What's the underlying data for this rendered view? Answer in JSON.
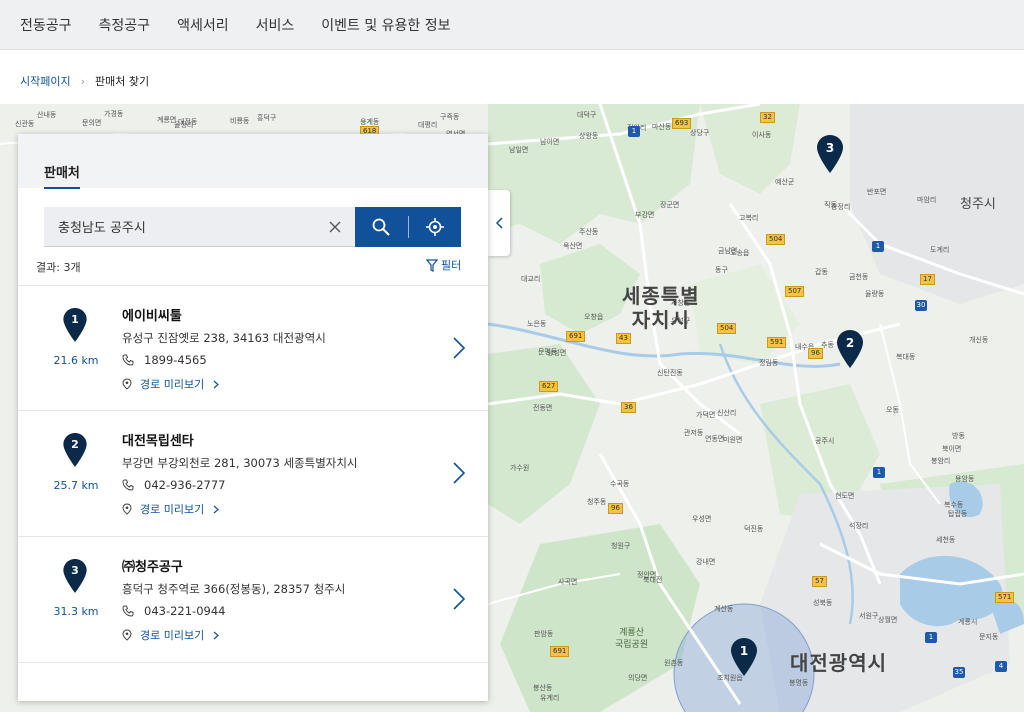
{
  "nav": {
    "items": [
      "전동공구",
      "측정공구",
      "액세서리",
      "서비스",
      "이벤트 및 유용한 정보"
    ]
  },
  "breadcrumb": {
    "home": "시작페이지",
    "current": "판매처 찾기"
  },
  "panel": {
    "tab_label": "판매처",
    "search": {
      "value": "충청남도 공주시"
    },
    "result_count": "결과: 3개",
    "filter_label": "필터",
    "route_label": "경로 미리보기",
    "results": [
      {
        "number": "1",
        "distance": "21.6 km",
        "name": "에이비씨툴",
        "address": "유성구 진잠옛로 238, 34163 대전광역시",
        "phone": "1899-4565"
      },
      {
        "number": "2",
        "distance": "25.7 km",
        "name": "대전목립센타",
        "address": "부강면 부강외천로 281, 30073 세종특별자치시",
        "phone": "042-936-2777"
      },
      {
        "number": "3",
        "distance": "31.3 km",
        "name": "㈜청주공구",
        "address": "흥덕구 청주역로 366(정봉동), 28357 청주시",
        "phone": "043-221-0944"
      }
    ]
  },
  "map": {
    "city_sejong_line1": "세종특별",
    "city_sejong_line2": "자치시",
    "city_daejeon": "대전광역시",
    "city_cheongju": "청주시",
    "mountain_line1": "계룡산",
    "mountain_line2": "국립공원",
    "pins": [
      "1",
      "2",
      "3"
    ],
    "labels": [
      "예산군",
      "신산리",
      "대평리",
      "정안면",
      "전동면",
      "송정리",
      "고복리",
      "연서면",
      "조치원읍",
      "연동면",
      "부강면",
      "금남면",
      "장군면",
      "유성구",
      "구즉동",
      "오송읍",
      "강내면",
      "옥산면",
      "남이면",
      "현도면",
      "신탄진동",
      "계산동",
      "동구",
      "반포면",
      "상월면",
      "계룡시",
      "공주시",
      "계룡면",
      "우성면",
      "의당면",
      "율정리",
      "유계리",
      "봉암리",
      "사곡면",
      "정안리",
      "석장리",
      "도계리",
      "상왕동",
      "신관동",
      "마암리",
      "대교리",
      "노은동",
      "북대전",
      "대덕구",
      "문평동",
      "비룡동",
      "용계동",
      "원촌동",
      "갑동",
      "판암동",
      "산내동",
      "가수원",
      "관저동",
      "정림동",
      "복수동",
      "탑립동",
      "문지동",
      "덕진동",
      "방동",
      "성북동",
      "봉산동",
      "추동",
      "오동",
      "세천동",
      "대전동",
      "직동",
      "주산동",
      "마산동",
      "이사동",
      "청주동",
      "율량동",
      "내수읍",
      "오창읍",
      "북이면",
      "문의면",
      "가덕면",
      "남일면",
      "미원면",
      "낭성면",
      "상당구",
      "서원구",
      "흥덕구",
      "청원구",
      "수곡동",
      "개신동",
      "복대동",
      "가경동",
      "봉명동",
      "사창동",
      "용암동",
      "금천동"
    ],
    "shields": [
      "618",
      "693",
      "1",
      "504",
      "507",
      "504",
      "591",
      "691",
      "43",
      "96",
      "627",
      "36",
      "1",
      "96",
      "57",
      "1",
      "691",
      "571",
      "35",
      "4",
      "30",
      "17",
      "1",
      "32"
    ]
  }
}
